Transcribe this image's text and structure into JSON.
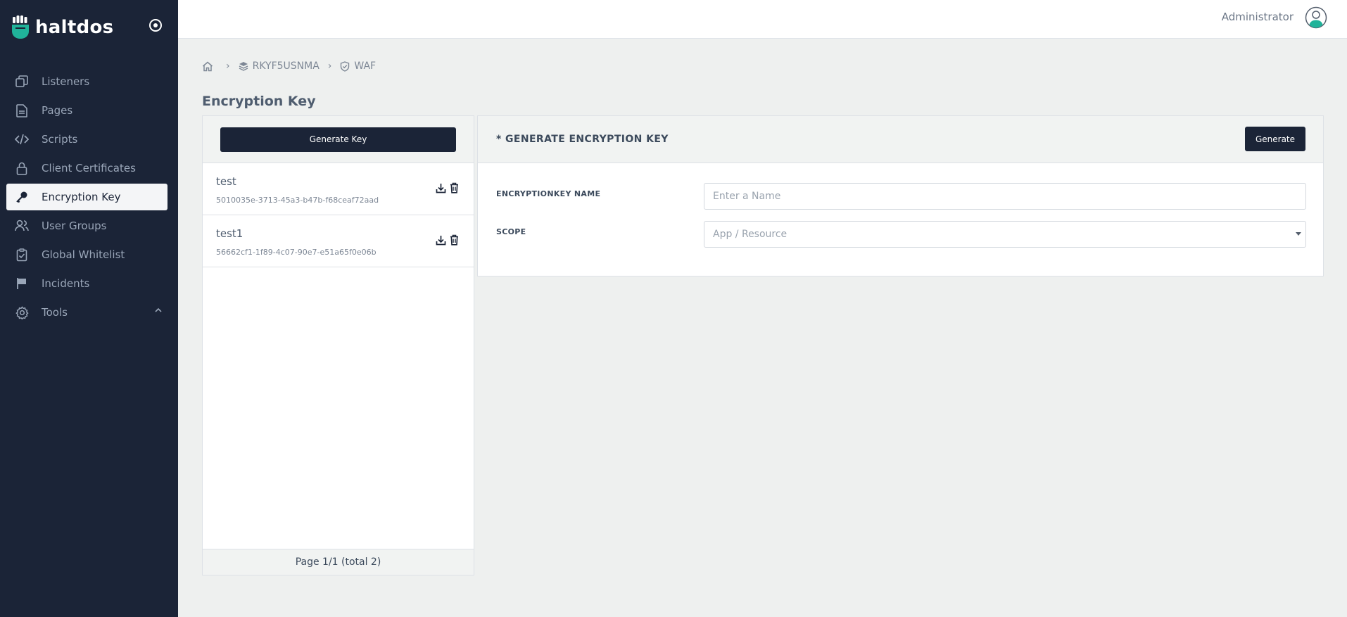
{
  "brand": {
    "name": "haltdos",
    "logo_icon": "fist-logo",
    "toggle_icon": "target-circle-icon",
    "accent": "#20b39a"
  },
  "sidebar": {
    "items": [
      {
        "label": "Listeners",
        "icon": "copy-windows-icon",
        "active": false
      },
      {
        "label": "Pages",
        "icon": "document-icon",
        "active": false
      },
      {
        "label": "Scripts",
        "icon": "code-icon",
        "active": false
      },
      {
        "label": "Client Certificates",
        "icon": "lock-icon",
        "active": false
      },
      {
        "label": "Encryption Key",
        "icon": "key-icon",
        "active": true
      },
      {
        "label": "User Groups",
        "icon": "users-icon",
        "active": false
      },
      {
        "label": "Global Whitelist",
        "icon": "clipboard-check-icon",
        "active": false
      },
      {
        "label": "Incidents",
        "icon": "flag-icon",
        "active": false
      },
      {
        "label": "Tools",
        "icon": "gear-icon",
        "active": false,
        "expandable": true
      }
    ]
  },
  "header": {
    "user_name": "Administrator",
    "avatar_icon": "user-avatar-icon"
  },
  "breadcrumb": {
    "home_icon": "home-icon",
    "items": [
      {
        "label": "RKYF5USNMA",
        "icon": "layers-icon"
      },
      {
        "label": "WAF",
        "icon": "shield-icon"
      }
    ],
    "separator": "›"
  },
  "page": {
    "title": "Encryption Key"
  },
  "key_list": {
    "generate_label": "Generate Key",
    "items": [
      {
        "name": "test",
        "id": "5010035e-3713-45a3-b47b-f68ceaf72aad"
      },
      {
        "name": "test1",
        "id": "56662cf1-1f89-4c07-90e7-e51a65f0e06b"
      }
    ],
    "pagination": "Page 1/1 (total 2)"
  },
  "form": {
    "title": "* GENERATE ENCRYPTION KEY",
    "generate_label": "Generate",
    "name_label": "ENCRYPTIONKEY NAME",
    "name_placeholder": "Enter a Name",
    "name_value": "",
    "scope_label": "SCOPE",
    "scope_placeholder": "App / Resource"
  },
  "colors": {
    "sidebar_bg": "#1b2437",
    "page_bg": "#eef0ef",
    "button_bg": "#1b2437"
  }
}
